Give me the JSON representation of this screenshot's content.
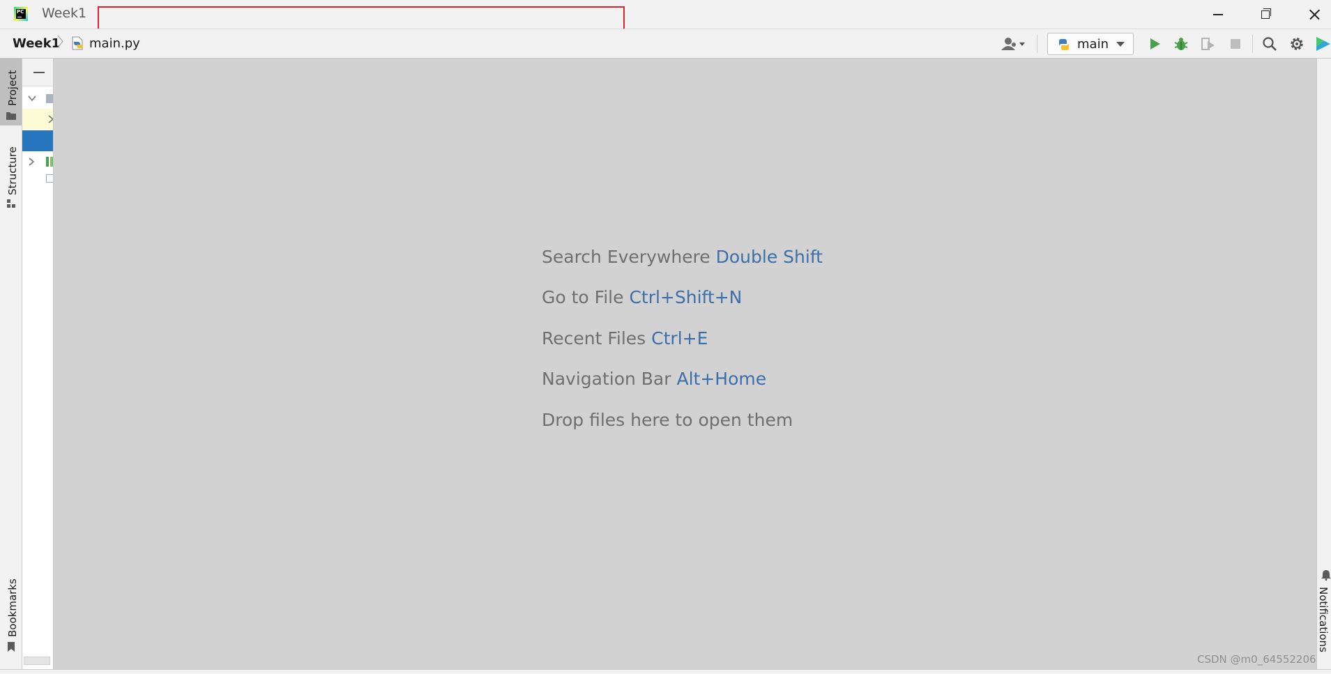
{
  "window": {
    "title": "Week1"
  },
  "breadcrumb": {
    "project": "Week1",
    "file": "main.py"
  },
  "toolbar": {
    "run_config": "main",
    "icons": [
      "user-icon",
      "python-icon",
      "run-icon",
      "debug-icon",
      "coverage-icon",
      "stop-icon",
      "search-icon",
      "gear-icon",
      "plugin-logo-icon"
    ]
  },
  "left_tools": {
    "project": "Project",
    "structure": "Structure",
    "bookmarks": "Bookmarks"
  },
  "right_tools": {
    "notifications": "Notifications"
  },
  "editor_hints": {
    "search_label": "Search Everywhere",
    "search_shortcut": "Double Shift",
    "goto_label": "Go to File",
    "goto_shortcut": "Ctrl+Shift+N",
    "recent_label": "Recent Files",
    "recent_shortcut": "Ctrl+E",
    "nav_label": "Navigation Bar",
    "nav_shortcut": "Alt+Home",
    "drop_label": "Drop files here to open them"
  },
  "watermark": "CSDN @m0_64552206",
  "colors": {
    "shortcut_text": "#3c6fa8",
    "editor_background": "#d2d2d2",
    "selection": "#2675bf",
    "highlight_box": "#e1222b",
    "run_green": "#4aa04d"
  }
}
